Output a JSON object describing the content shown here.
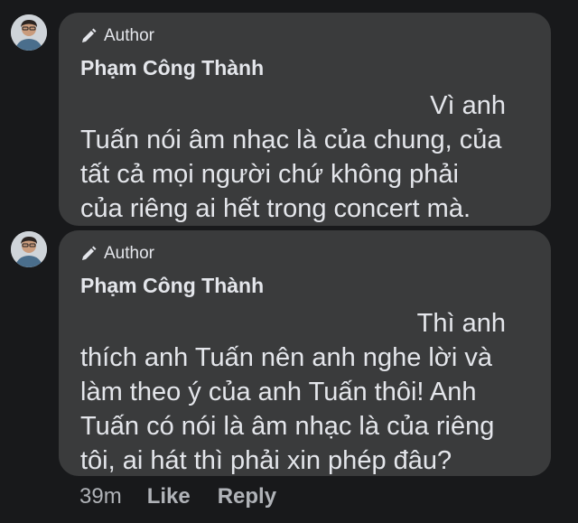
{
  "comments": [
    {
      "badge": "Author",
      "badge_icon": "pencil-icon",
      "author": "Phạm Công Thành",
      "text_first_line": "Vì anh",
      "text_lines": [
        "Tuấn nói âm nhạc là của chung, của",
        "tất cả mọi người chứ không phải",
        "của riêng ai hết trong concert mà."
      ]
    },
    {
      "badge": "Author",
      "badge_icon": "pencil-icon",
      "author": "Phạm Công Thành",
      "text_first_line": "Thì anh",
      "text_lines": [
        "thích anh Tuấn nên anh nghe lời và",
        "làm theo ý của anh Tuấn thôi! Anh",
        "Tuấn có nói là âm nhạc là của riêng",
        "tôi, ai hát thì phải xin phép đâu?"
      ]
    }
  ],
  "actions": {
    "time": "39m",
    "like": "Like",
    "reply": "Reply"
  },
  "colors": {
    "background": "#18191b",
    "bubble": "#3a3b3c",
    "text": "#e4e6eb",
    "secondary_text": "#b0b3b8"
  }
}
